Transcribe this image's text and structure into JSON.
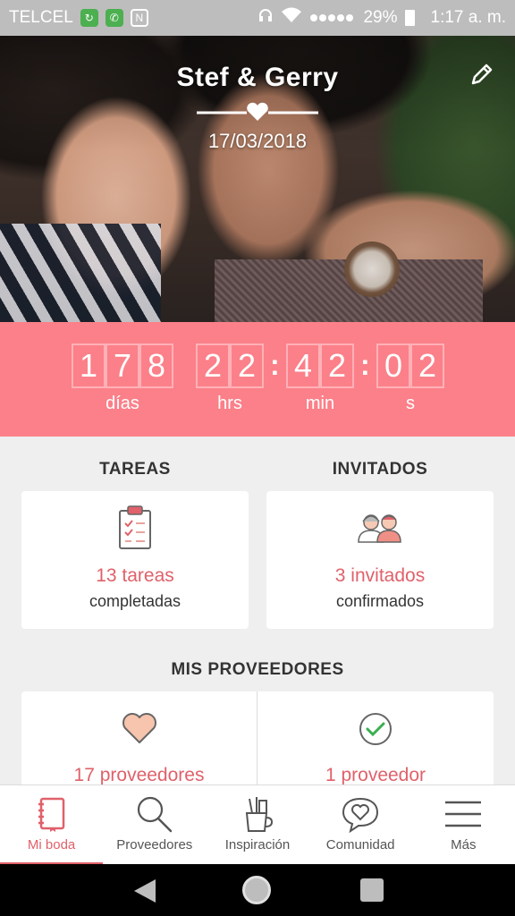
{
  "status_bar": {
    "carrier": "TELCEL",
    "battery": "29%",
    "time": "1:17 a. m.",
    "icons": [
      "sync-icon",
      "whatsapp-icon",
      "nfc-icon",
      "headphones-icon",
      "wifi-icon",
      "signal-icon",
      "battery-icon"
    ]
  },
  "hero": {
    "names": "Stef & Gerry",
    "date": "17/03/2018",
    "edit_icon": "pencil-icon"
  },
  "countdown": {
    "days": [
      "1",
      "7",
      "8"
    ],
    "hours": [
      "2",
      "2"
    ],
    "minutes": [
      "4",
      "2"
    ],
    "seconds": [
      "0",
      "2"
    ],
    "labels": {
      "days": "días",
      "hours": "hrs",
      "minutes": "min",
      "seconds": "s"
    }
  },
  "tasks": {
    "title": "TAREAS",
    "count": "13 tareas",
    "sub": "completadas",
    "icon": "clipboard-icon"
  },
  "guests": {
    "title": "INVITADOS",
    "count": "3 invitados",
    "sub": "confirmados",
    "icon": "couple-icon"
  },
  "vendors": {
    "title": "MIS PROVEEDORES",
    "left": {
      "count": "17 proveedores",
      "icon": "heart-icon"
    },
    "right": {
      "count": "1 proveedor",
      "icon": "check-circle-icon"
    }
  },
  "nav": {
    "items": [
      {
        "label": "Mi boda",
        "icon": "notebook-icon",
        "active": true
      },
      {
        "label": "Proveedores",
        "icon": "search-icon",
        "active": false
      },
      {
        "label": "Inspiración",
        "icon": "pencil-cup-icon",
        "active": false
      },
      {
        "label": "Comunidad",
        "icon": "chat-heart-icon",
        "active": false
      },
      {
        "label": "Más",
        "icon": "menu-icon",
        "active": false
      }
    ]
  },
  "colors": {
    "accent": "#e0616a",
    "countdown_bg": "#fb8089",
    "status_bar": "#bdbdbd"
  }
}
